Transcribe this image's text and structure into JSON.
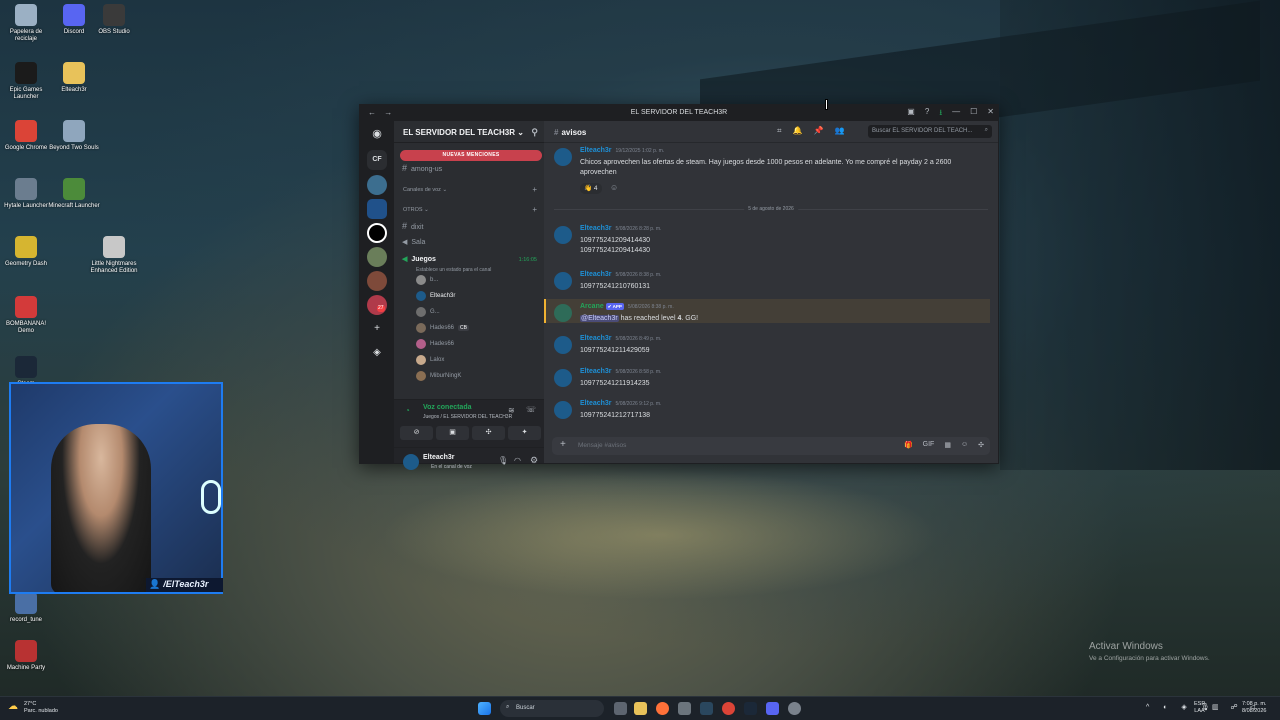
{
  "desktop_icons": [
    {
      "label": "Papelera de reciclaje",
      "icon": "recycle-bin-icon",
      "color": "#9bb0c4"
    },
    {
      "label": "Discord",
      "icon": "discord-icon",
      "color": "#5865f2"
    },
    {
      "label": "OBS Studio",
      "icon": "obs-icon",
      "color": "#3a3a3a"
    },
    {
      "label": "Epic Games Launcher",
      "icon": "epic-icon",
      "color": "#1b1b1b"
    },
    {
      "label": "Elteach3r",
      "icon": "folder-icon",
      "color": "#e8c25a"
    },
    {
      "label": "Google Chrome",
      "icon": "chrome-icon",
      "color": "#db4437"
    },
    {
      "label": "Beyond Two Souls",
      "icon": "game-icon",
      "color": "#8fa6bd"
    },
    {
      "label": "Hytale Launcher",
      "icon": "hytale-icon",
      "color": "#6b7d8f"
    },
    {
      "label": "Minecraft Launcher",
      "icon": "minecraft-icon",
      "color": "#4c8b3a"
    },
    {
      "label": "Geometry Dash",
      "icon": "geometry-dash-icon",
      "color": "#d6b530"
    },
    {
      "label": "Little Nightmares Enhanced Edition",
      "icon": "little-nightmares-icon",
      "color": "#c8c8c8"
    },
    {
      "label": "BOMBANANA! Demo",
      "icon": "bombanana-icon",
      "color": "#d33a3a"
    },
    {
      "label": "Steam",
      "icon": "steam-icon",
      "color": "#1b2838"
    },
    {
      "label": "record_tune",
      "icon": "record-icon",
      "color": "#4a6fa5"
    },
    {
      "label": "Machine Party",
      "icon": "machine-party-icon",
      "color": "#b83232"
    }
  ],
  "window": {
    "title": "EL SERVIDOR DEL TEACH3R",
    "back": "←",
    "forward": "→",
    "controls": [
      "▣",
      "?",
      "⭳",
      "—",
      "☐",
      "✕"
    ]
  },
  "server_rail": {
    "home": "◉",
    "folder_label": "CF",
    "badge_count": "27",
    "add": "+",
    "explore": "◈"
  },
  "sidebar": {
    "server_name": "EL SERVIDOR DEL TEACH3R",
    "chevron": "⌄",
    "new_mentions": "NUEVAS MENCIONES",
    "channels_top": [
      {
        "name": "among-us"
      }
    ],
    "category_voice": "Canales de voz",
    "category_others": "OTROS",
    "others": [
      {
        "name": "dixit",
        "kind": "text"
      },
      {
        "name": "Sala",
        "kind": "voice"
      }
    ],
    "active_voice": {
      "name": "Juegos",
      "timer": "1:16:05",
      "status": "Establece un estado para el canal"
    },
    "members": [
      {
        "name": "b...",
        "color": "#8b8b8b"
      },
      {
        "name": "Elteach3r",
        "color": "#1d5b8a"
      },
      {
        "name": "G...",
        "color": "#6e6e6e"
      },
      {
        "name": "Hades66",
        "badge": "CB",
        "color": "#7a6a5a"
      },
      {
        "name": "Hades66",
        "color": "#b35f8a"
      },
      {
        "name": "Lalox",
        "color": "#c7a98c"
      },
      {
        "name": "MiburNingK",
        "color": "#8a6e52"
      }
    ],
    "voice_panel": {
      "status": "Voz conectada",
      "location": "Juegos / EL SERVIDOR DEL TEACH3R",
      "buttons": [
        "⊘",
        "▣",
        "✣",
        "✦"
      ]
    },
    "user_panel": {
      "name": "Elteach3r",
      "status": "En el canal de voz"
    }
  },
  "chat": {
    "channel": "avisos",
    "header_icons": [
      "⌗",
      "🔔",
      "📌",
      "👥"
    ],
    "search_placeholder": "Buscar EL SERVIDOR DEL TEACH...",
    "messages": [
      {
        "author": "Elteach3r",
        "time": "19/12/2025 1:02 p. m.",
        "text": "Chicos aprovechen las ofertas de steam. Hay juegos desde 1000 pesos en adelante. Yo me compré el payday 2 a 2600 aprovechen",
        "reaction_emoji": "👋",
        "reaction_count": "4"
      },
      {
        "divider": "5 de agosto de 2026"
      },
      {
        "author": "Elteach3r",
        "time": "5/08/2026 8:28 p. m.",
        "lines": [
          "1097752412094144​30",
          "109775241209414430"
        ]
      },
      {
        "author": "Elteach3r",
        "time": "5/08/2026 8:38 p. m.",
        "text": "1097752412107601​31"
      },
      {
        "author": "Arcane",
        "tag": "✔ APP",
        "time": "5/08/2026 8:38 p. m.",
        "mention": "@Elteach3r",
        "after": "has reached level",
        "level": "4",
        "suffix": ". GG!"
      },
      {
        "author": "Elteach3r",
        "time": "5/08/2026 8:49 p. m.",
        "text": "109775241211429059"
      },
      {
        "author": "Elteach3r",
        "time": "5/08/2026 8:58 p. m.",
        "text": "109775241211914235"
      },
      {
        "author": "Elteach3r",
        "time": "5/08/2026 9:12 p. m.",
        "text": "109775241212717138"
      }
    ],
    "composer_placeholder": "Mensaje #avisos",
    "composer_icons": [
      "🎁",
      "GIF",
      "▦",
      "☺",
      "✣"
    ]
  },
  "webcam": {
    "label": "/ElTeach3r"
  },
  "watermark": {
    "title": "Activar Windows",
    "subtitle": "Ve a Configuración para activar Windows."
  },
  "taskbar": {
    "weather_temp": "27°C",
    "weather_desc": "Parc. nublado",
    "search_placeholder": "Buscar",
    "lang_top": "ESP",
    "lang_bottom": "LAA",
    "time": "7:08 p. m.",
    "date": "8/08/2026"
  },
  "colors": {
    "discord_bg": "#313338",
    "sidebar_bg": "#2b2d31",
    "rail_bg": "#1e1f22",
    "mention_red": "#c8414d",
    "author_blue": "#1e90d6",
    "voice_green": "#23a55a"
  }
}
